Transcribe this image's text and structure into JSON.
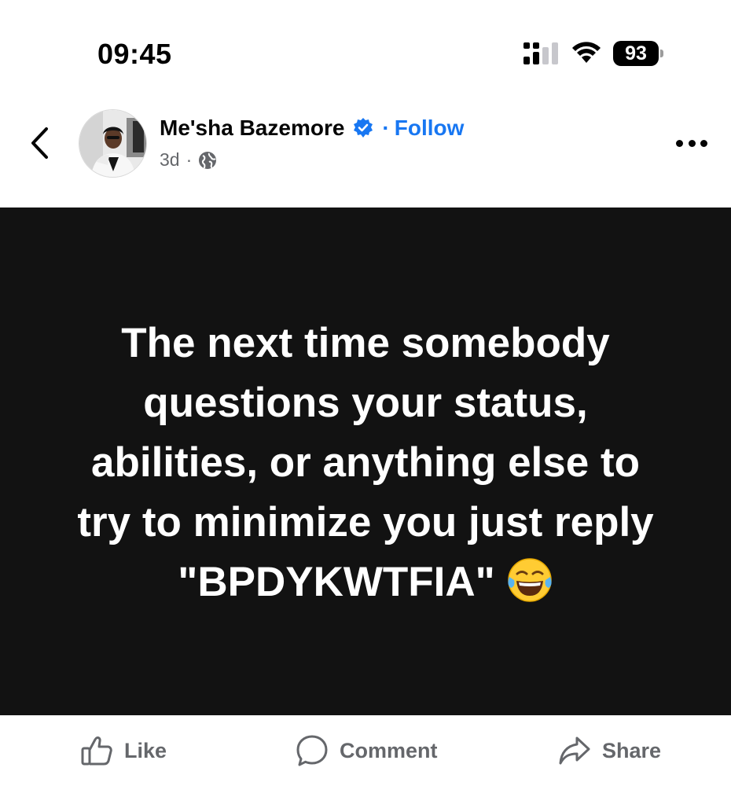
{
  "status_bar": {
    "time": "09:45",
    "battery_level": "93",
    "icons": [
      "signal-icon",
      "wifi-icon",
      "battery-icon"
    ]
  },
  "post": {
    "author": {
      "name": "Me'sha Bazemore",
      "verified": true,
      "follow_label": "Follow",
      "separator": "·"
    },
    "meta": {
      "age": "3d",
      "separator": "·",
      "audience_icon": "globe-icon"
    },
    "content": {
      "text": "The next time somebody questions your status, abilities, or anything else to try to minimize you just reply \"BPDYKWTFIA\"",
      "emoji": "face-with-tears-of-joy",
      "background_color": "#121212",
      "text_color": "#ffffff"
    }
  },
  "actions": {
    "like_label": "Like",
    "comment_label": "Comment",
    "share_label": "Share"
  },
  "colors": {
    "accent": "#1877f2",
    "secondary_text": "#65676b",
    "primary_text": "#050505"
  }
}
